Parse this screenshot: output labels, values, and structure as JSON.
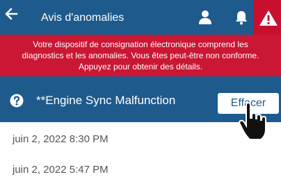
{
  "header": {
    "title": "Avis d'anomalies",
    "back_icon": "back-arrow-icon",
    "user_icon": "user-icon",
    "bell_icon": "bell-icon",
    "alert_icon": "warning-icon",
    "bar_color": "#1e5a8c",
    "alert_color": "#c8102e"
  },
  "banner": {
    "lines": [
      "Votre dispositif de consignation électronique comprend les",
      "diagnostics et les anomalies. Vous êtes peut-être non conforme.",
      "Appuyez pour obtenir des détails."
    ],
    "color": "#c8102e"
  },
  "fault": {
    "title": "**Engine Sync Malfunction",
    "clear_label": "Effacer",
    "help_icon": "question-circle-icon",
    "cursor_icon": "hand-pointer-icon"
  },
  "log": {
    "entries": [
      "juin 2, 2022 8:30 PM",
      "juin 2, 2022 5:47 PM"
    ]
  }
}
